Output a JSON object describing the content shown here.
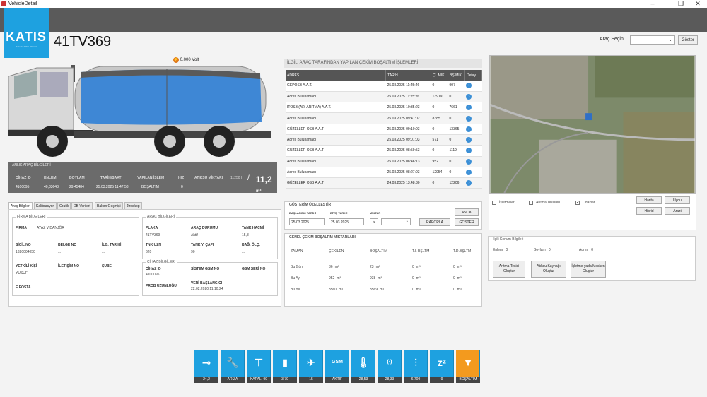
{
  "window": {
    "title": "VehicleDetail"
  },
  "logo": {
    "text": "KATIS",
    "subtitle": "Katı Atık Takip Sistemi"
  },
  "vehicle": {
    "plate": "41TV369",
    "voltage": "0.000",
    "volt_unit": "Volt"
  },
  "top": {
    "arac_sec_label": "Araç Seçin",
    "goster_label": "Göster"
  },
  "anlik": {
    "title": "ANLIK ARAÇ BİLGİLERİ",
    "headers": [
      "CİHAZ ID",
      "ENLEM",
      "BOYLAM",
      "TARİH/SAAT",
      "YAPILAN İŞLEM",
      "HIZ",
      "ATIKSU MİKTARI"
    ],
    "values": [
      "4100095",
      "40,83643",
      "29,45484",
      "25.03.2025 11:47:58",
      "BOŞALTIM",
      "0"
    ],
    "capacity": "11250 l",
    "slash": "/",
    "big_value": "11,2",
    "big_unit": "m³"
  },
  "tabs": [
    "Araç Bilgileri",
    "Kalibrasyon",
    "Grafik",
    "DB Verileri",
    "Bakım Geçmişi",
    "Jiroskop"
  ],
  "firma": {
    "title": "FİRMA BİLGİLERİ",
    "firma_label": "FİRMA",
    "firma_value": "AYAZ VİDANJÖR",
    "sicil_label": "SİCİL NO",
    "sicil_value": "1320004050",
    "belge_label": "BELGE NO",
    "belge_value": "...",
    "ilg_label": "İLG. TARİHİ",
    "ilg_value": "...",
    "yetkili_label": "YETKİLİ KİŞİ",
    "yetkili_value": "YUSUF",
    "iletisim_label": "İLETİŞİM NO",
    "sube_label": "ŞUBE",
    "eposta_label": "E POSTA"
  },
  "arac": {
    "title": "ARAÇ BİLGİLERİ",
    "plaka_label": "PLAKA",
    "plaka_value": "41TV369",
    "durum_label": "ARAÇ DURUMU",
    "durum_value": "Aktif",
    "tank_label": "TANK HACMİ",
    "tank_value": "15,8",
    "tnk_uzn_label": "TNK UZN",
    "tnk_uzn_value": "620",
    "capi_label": "TANK Y. ÇAPI",
    "capi_value": "90",
    "bag_label": "BAĞ. ÖLÇ.",
    "bag_value": "..."
  },
  "cihaz": {
    "title": "CİHAZ BİLGİLERİ",
    "id_label": "CİHAZ ID",
    "id_value": "4100095",
    "gsm_label": "SİSTEM GSM NO",
    "seri_label": "GSM SERİ NO",
    "prob_label": "PROB UZUNLUĞU",
    "prob_value": "...",
    "veri_label": "VERİ BAŞLANGICI",
    "veri_value": "22.02.2020 11:10:24"
  },
  "islem": {
    "title": "İLGİLİ ARAÇ TARAFINDAN YAPILAN ÇEKİM BOŞALTIM İŞLEMLERİ",
    "headers": [
      "ADRES",
      "TARİH",
      "ÇL MİK",
      "BŞ MİK",
      "Detay"
    ],
    "rows": [
      [
        "GEPOSB A.A.T.",
        "25.03.2025 11:45:46",
        "0",
        "907"
      ],
      [
        "Adres Bulunamadı",
        "25.03.2025 11:25:26",
        "13919",
        "0"
      ],
      [
        "İTOSB (ARI ARITMA) A.A.T.",
        "25.03.2025 10:35:23",
        "0",
        "7661"
      ],
      [
        "Adres Bulunamadı",
        "25.03.2025 09:41:02",
        "8385",
        "0"
      ],
      [
        "GÜZELLER OSB A.A.T",
        "25.03.2025 09:10:03",
        "0",
        "13365"
      ],
      [
        "Adres Bulunamadı",
        "25.03.2025 09:01:03",
        "571",
        "0"
      ],
      [
        "GÜZELLER OSB A.A.T",
        "25.03.2025 08:59:53",
        "0",
        "1119"
      ],
      [
        "Adres Bulunamadı",
        "25.03.2025 08:46:13",
        "952",
        "0"
      ],
      [
        "Adres Bulunamadı",
        "25.03.2025 08:27:03",
        "12954",
        "0"
      ],
      [
        "GÜZELLER OSB A.A.T",
        "24.03.2025 13:48:30",
        "0",
        "12206"
      ]
    ]
  },
  "gosterim": {
    "title": "GÖSTERİM ÖZELLEŞTİR",
    "bas_label": "BAŞLANGIÇ TARİHİ",
    "bas_value": "25.03.2025",
    "bit_label": "BİTİŞ TARİHİ",
    "bit_value": "25.03.2025",
    "miktar_label": "MİKTAR",
    "miktar_op": ">",
    "raporla": "RAPORLA",
    "goster": "GÖSTER",
    "anlik": "ANLIK"
  },
  "genel": {
    "title": "GENEL ÇEKİM BOŞALTIM MİKTARLARI",
    "headers": [
      "ZAMAN",
      "ÇEKİLEN",
      "BOŞALTIM",
      "T.İ. BŞLTM",
      "T.D.BŞLTM"
    ],
    "rows": [
      [
        "Bu Gün",
        "36",
        "23",
        "0",
        "0"
      ],
      [
        "Bu Ay",
        "952",
        "938",
        "0",
        "0"
      ],
      [
        "Bu Yıl",
        "3560",
        "3569",
        "0",
        "0"
      ]
    ],
    "unit": "m³"
  },
  "map": {
    "isletmeler": "İşletmeler",
    "aritma": "Arıtma Tesisleri",
    "odaklar": "Odaklar",
    "harita": "Harita",
    "uydu": "Uydu",
    "hibrid": "Hibrid",
    "arazi": "Arazi"
  },
  "ilgili": {
    "title": "İlgili Konum Bilgileri",
    "enlem_label": "Enlem",
    "enlem_value": "0",
    "boylam_label": "Boylam",
    "boylam_value": "0",
    "adres_label": "Adres",
    "adres_value": "0",
    "btn1": "Arıtma Tesisi Oluştur",
    "btn2": "Atıksu Kaynağı Oluştur",
    "btn3": "İşletme yada Mesken Oluştur"
  },
  "bottom": [
    {
      "icon": "pipe-icon",
      "glyph": "⊸",
      "value": "24,2"
    },
    {
      "icon": "wrench-icon",
      "glyph": "🔧",
      "value": "ARIZA"
    },
    {
      "icon": "valve-icon",
      "glyph": "⊤",
      "value": "KAPALI 99"
    },
    {
      "icon": "battery-icon",
      "glyph": "▮",
      "value": "3,79"
    },
    {
      "icon": "satellite-icon",
      "glyph": "✈",
      "value": "15"
    },
    {
      "icon": "gsm-icon",
      "glyph": "GSM",
      "value": "AKTİF"
    },
    {
      "icon": "thermometer-icon",
      "glyph": "🌡",
      "value": "28,53"
    },
    {
      "icon": "signal-icon",
      "glyph": "(·)",
      "value": "28,33"
    },
    {
      "icon": "sliders-icon",
      "glyph": "⫶",
      "value": "6,709"
    },
    {
      "icon": "sleep-icon",
      "glyph": "zᶻ",
      "value": "9"
    },
    {
      "icon": "arrow-down-icon",
      "glyph": "▼",
      "value": "BOŞALTIM"
    }
  ]
}
